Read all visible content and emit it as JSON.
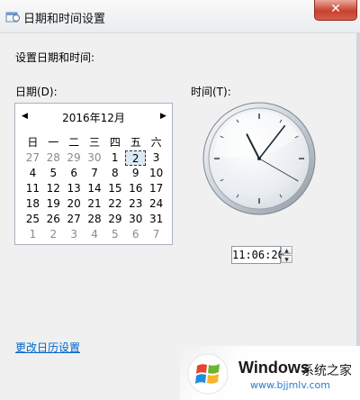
{
  "window": {
    "title": "日期和时间设置",
    "close_label": "✕"
  },
  "heading": "设置日期和时间:",
  "date_label": "日期(D):",
  "time_label": "时间(T):",
  "calendar": {
    "prev_icon": "◀",
    "next_icon": "▶",
    "month": "2016年12月",
    "weekdays": [
      "日",
      "一",
      "二",
      "三",
      "四",
      "五",
      "六"
    ],
    "weeks": [
      [
        "27",
        "28",
        "29",
        "30",
        "1",
        "2",
        "3"
      ],
      [
        "4",
        "5",
        "6",
        "7",
        "8",
        "9",
        "10"
      ],
      [
        "11",
        "12",
        "13",
        "14",
        "15",
        "16",
        "17"
      ],
      [
        "18",
        "19",
        "20",
        "21",
        "22",
        "23",
        "24"
      ],
      [
        "25",
        "26",
        "27",
        "28",
        "29",
        "30",
        "31"
      ],
      [
        "1",
        "2",
        "3",
        "4",
        "5",
        "6",
        "7"
      ]
    ],
    "selected": "2"
  },
  "clock": {
    "hour": 11,
    "minute": 6,
    "second": 20
  },
  "time_value": "11:06:20",
  "link": "更改日历设置",
  "watermark": {
    "brand": "Windows",
    "cn": "系统之家",
    "url": "www.bjjmlv.com"
  },
  "colors": {
    "link": "#0066cc",
    "close": "#c8412f",
    "selection": "#dbe8f6"
  }
}
